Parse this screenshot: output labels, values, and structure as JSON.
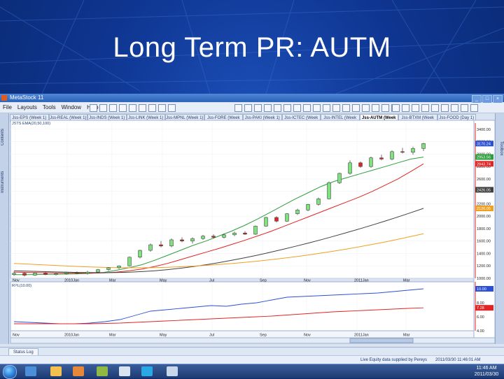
{
  "slide": {
    "title": "Long Term PR: AUTM"
  },
  "window": {
    "title": "MetaStock 11",
    "buttons": [
      "_",
      "□",
      "×"
    ]
  },
  "menu": [
    "File",
    "Layouts",
    "Tools",
    "Window",
    "Help"
  ],
  "tabs": [
    "Jss-EPS (Week 1)",
    "Jss-REAL (Week 1)",
    "Jss-INDS (Week 1)",
    "Jss-LINK (Week 1)",
    "Jss-MPNL (Week 1)",
    "Jss-FORE (Week 1)",
    "Jss-PAKI (Week 1)",
    "Jss-ICTEC (Week 1)",
    "Jss-INTEL (Week 1)",
    "Jss-AUTM (Week 1)",
    "Jss-BTXM (Week 1)",
    "Jss-FOOD (Day 1)"
  ],
  "active_tab_index": 9,
  "left_panel_tabs": [
    "Contents",
    "Instruments"
  ],
  "right_panel_tabs": [
    "Toolbox"
  ],
  "price_panel": {
    "header": "JSTS EMA(20,50,100)",
    "y_ticks": [
      "3400.00",
      "3200.00",
      "3000.00",
      "2800.00",
      "2600.00",
      "2400.00",
      "2200.00",
      "2000.00",
      "1800.00",
      "1600.00",
      "1400.00",
      "1200.00",
      "1000.00"
    ],
    "last_price_tags": [
      {
        "text": "3170.24",
        "color": "#2b4fd6"
      },
      {
        "text": "2953.56",
        "color": "#2e9e3c"
      },
      {
        "text": "2843.74",
        "color": "#e02424"
      },
      {
        "text": "2426.05",
        "color": "#404040"
      },
      {
        "text": "2126.05",
        "color": "#f0a020"
      }
    ]
  },
  "indicator_panel": {
    "header": "RPL(10.00)",
    "y_ticks": [
      "10.00",
      "8.00",
      "6.00",
      "4.00"
    ],
    "last_tags": [
      {
        "text": "10.00",
        "color": "#2b4fd6"
      },
      {
        "text": "7.28",
        "color": "#e02424"
      }
    ]
  },
  "x_ticks": [
    "Nov",
    "2010Jan",
    "Mar",
    "May",
    "Jul",
    "Sep",
    "Nov",
    "2011Jan",
    "Mar"
  ],
  "status_tab": "Status Log",
  "info_bar": {
    "message": "Live Equity data supplied by Pereys",
    "timestamp": "2011/03/30 11:46:01 AM"
  },
  "taskbar": {
    "clock_time": "11:46 AM",
    "clock_date": "2011/03/30"
  },
  "chart_data": {
    "type": "candlestick",
    "title": "",
    "series": [
      {
        "name": "EMA 20",
        "color": "#2e9e3c",
        "values": [
          1060,
          1060,
          1062,
          1065,
          1068,
          1072,
          1080,
          1095,
          1130,
          1170,
          1220,
          1290,
          1370,
          1450,
          1530,
          1600,
          1680,
          1760,
          1850,
          1950,
          2060,
          2170,
          2280,
          2380,
          2480,
          2560,
          2620,
          2680,
          2740,
          2800,
          2860,
          2920,
          2953
        ]
      },
      {
        "name": "EMA 50",
        "color": "#e02424",
        "values": [
          1100,
          1095,
          1090,
          1088,
          1085,
          1083,
          1083,
          1088,
          1100,
          1120,
          1150,
          1190,
          1240,
          1300,
          1360,
          1420,
          1480,
          1545,
          1610,
          1680,
          1750,
          1830,
          1910,
          1990,
          2070,
          2150,
          2230,
          2310,
          2400,
          2500,
          2600,
          2720,
          2843
        ]
      },
      {
        "name": "EMA 100",
        "color": "#404040",
        "values": [
          1120,
          1115,
          1110,
          1105,
          1100,
          1095,
          1092,
          1090,
          1092,
          1098,
          1108,
          1122,
          1140,
          1162,
          1188,
          1218,
          1252,
          1290,
          1330,
          1372,
          1418,
          1466,
          1516,
          1568,
          1622,
          1678,
          1736,
          1796,
          1858,
          1922,
          1988,
          2056,
          2126
        ]
      },
      {
        "name": "EMA 200",
        "color": "#f0a020",
        "values": [
          1240,
          1230,
          1220,
          1210,
          1200,
          1190,
          1182,
          1176,
          1172,
          1170,
          1170,
          1172,
          1178,
          1186,
          1196,
          1208,
          1222,
          1238,
          1256,
          1276,
          1298,
          1322,
          1348,
          1376,
          1406,
          1438,
          1472,
          1508,
          1546,
          1586,
          1628,
          1672,
          1718
        ]
      }
    ],
    "candles": [
      [
        1060,
        1110,
        1040,
        1080
      ],
      [
        1080,
        1095,
        1030,
        1050
      ],
      [
        1050,
        1090,
        1040,
        1085
      ],
      [
        1085,
        1100,
        1050,
        1060
      ],
      [
        1060,
        1090,
        1045,
        1075
      ],
      [
        1075,
        1100,
        1060,
        1090
      ],
      [
        1090,
        1110,
        1070,
        1080
      ],
      [
        1080,
        1120,
        1060,
        1100
      ],
      [
        1100,
        1150,
        1090,
        1140
      ],
      [
        1140,
        1180,
        1120,
        1170
      ],
      [
        1170,
        1210,
        1150,
        1200
      ],
      [
        1200,
        1350,
        1190,
        1340
      ],
      [
        1340,
        1460,
        1320,
        1450
      ],
      [
        1450,
        1560,
        1430,
        1540
      ],
      [
        1540,
        1600,
        1500,
        1520
      ],
      [
        1520,
        1640,
        1500,
        1620
      ],
      [
        1620,
        1660,
        1580,
        1600
      ],
      [
        1600,
        1660,
        1560,
        1640
      ],
      [
        1640,
        1700,
        1620,
        1680
      ],
      [
        1680,
        1710,
        1640,
        1660
      ],
      [
        1660,
        1720,
        1640,
        1700
      ],
      [
        1700,
        1750,
        1680,
        1730
      ],
      [
        1730,
        1760,
        1700,
        1710
      ],
      [
        1710,
        1850,
        1700,
        1840
      ],
      [
        1840,
        1990,
        1830,
        1980
      ],
      [
        1980,
        2000,
        1900,
        1920
      ],
      [
        1920,
        2050,
        1910,
        2040
      ],
      [
        2040,
        2120,
        2020,
        2100
      ],
      [
        2100,
        2200,
        2080,
        2190
      ],
      [
        2190,
        2300,
        2170,
        2280
      ],
      [
        2280,
        2560,
        2270,
        2540
      ],
      [
        2540,
        2700,
        2520,
        2690
      ],
      [
        2690,
        2900,
        2670,
        2860
      ],
      [
        2860,
        2880,
        2780,
        2800
      ],
      [
        2800,
        2960,
        2780,
        2940
      ],
      [
        2940,
        2990,
        2900,
        2920
      ],
      [
        2920,
        3060,
        2900,
        3040
      ],
      [
        3040,
        3100,
        3010,
        3030
      ],
      [
        3030,
        3120,
        2990,
        3090
      ],
      [
        3090,
        3180,
        3050,
        3170
      ]
    ],
    "indicator": [
      {
        "name": "RPL",
        "color": "#2b4fd6",
        "values": [
          5.3,
          5.2,
          5.1,
          5.0,
          5.0,
          5.1,
          5.3,
          5.6,
          6.2,
          6.8,
          7.0,
          7.2,
          7.4,
          7.6,
          7.5,
          7.8,
          8.0,
          8.4,
          8.8,
          8.9,
          9.0,
          9.1,
          9.2,
          9.3,
          9.4,
          9.6,
          9.8,
          10.0
        ]
      },
      {
        "name": "RPL signal",
        "color": "#e02424",
        "values": [
          5.0,
          5.0,
          5.0,
          5.0,
          5.0,
          5.0,
          5.05,
          5.1,
          5.2,
          5.3,
          5.4,
          5.5,
          5.6,
          5.7,
          5.8,
          5.9,
          6.0,
          6.1,
          6.25,
          6.4,
          6.55,
          6.7,
          6.8,
          6.9,
          7.0,
          7.1,
          7.2,
          7.28
        ]
      }
    ],
    "ylim": [
      1000,
      3500
    ],
    "indicator_ylim": [
      4,
      11
    ]
  }
}
